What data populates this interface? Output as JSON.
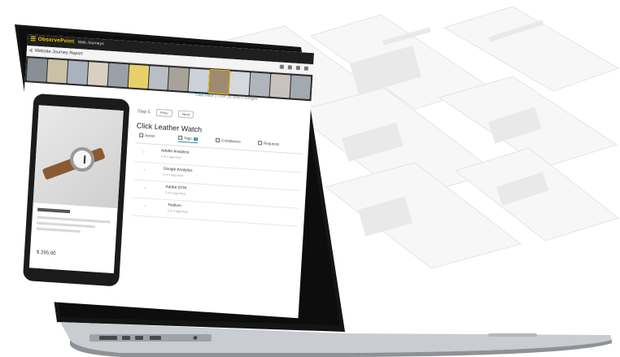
{
  "app": {
    "brand": "ObservePoint",
    "nav_item": "Web Journeys",
    "report_title": "Website Journey Report"
  },
  "toolbar": {
    "link_active": "Click Here 1",
    "link_secondary": "Live Do Web Changes"
  },
  "step": {
    "label": "Step 5",
    "prev_button": "Prev",
    "next_button": "Next",
    "title": "Click Leather Watch"
  },
  "tabs": [
    {
      "label": "Action"
    },
    {
      "label": "Tags",
      "badge": "3"
    },
    {
      "label": "Compliance"
    },
    {
      "label": "Requests"
    }
  ],
  "results": [
    {
      "name": "Adobe Analytics",
      "sub": "3 of 4 tags fired"
    },
    {
      "name": "Google Analytics",
      "sub": "3 of 4 tags fired"
    },
    {
      "name": "Adobe DTM",
      "sub": "3 of 4 tags fired"
    },
    {
      "name": "Tealium",
      "sub": "3 of 4 tags fired"
    }
  ],
  "product": {
    "price": "$ 295.00"
  },
  "colors": {
    "brand_yellow": "#f5c400",
    "accent_blue": "#1a8fb5",
    "topbar": "#1f1f1f"
  }
}
